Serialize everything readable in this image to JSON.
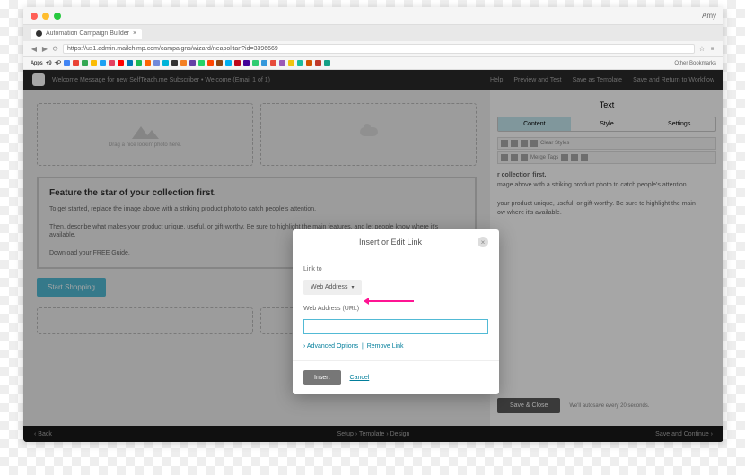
{
  "browser": {
    "user": "Amy",
    "tab": "Automation Campaign Builder",
    "url": "https://us1.admin.mailchimp.com/campaigns/wizard/neapolitan?id=3396669",
    "apps": "Apps",
    "other": "Other Bookmarks",
    "bm1": "+9",
    "bm2": "+P"
  },
  "app": {
    "title": "Welcome Message for new SelfTeach.me Subscriber • Welcome (Email 1 of 1)",
    "help": "Help",
    "preview": "Preview and Test",
    "savetpl": "Save as Template",
    "saveret": "Save and Return to Workflow"
  },
  "editor": {
    "placeholder": "Drag a nice lookin' photo here.",
    "heading": "Feature the star of your collection first.",
    "p1": "To get started, replace the image above with a striking product photo to catch people's attention.",
    "p2": "Then, describe what makes your product unique, useful, or gift-worthy. Be sure to highlight the main features, and let people know where it's available.",
    "p3": "Download your FREE Guide.",
    "shop": "Start Shopping"
  },
  "right": {
    "title": "Text",
    "tab1": "Content",
    "tab2": "Style",
    "tab3": "Settings",
    "clear": "Clear Styles",
    "merge": "Merge Tags",
    "h1": "r collection first.",
    "h2": "mage above with a striking product photo to catch people's attention.",
    "h3": "your product unique, useful, or gift-worthy. Be sure to highlight the main",
    "h4": "ow where it's available.",
    "save": "Save & Close",
    "auto": "We'll autosave every 20 seconds."
  },
  "modal": {
    "title": "Insert or Edit Link",
    "linkto": "Link to",
    "dropdown": "Web Address",
    "urllabel": "Web Address (URL)",
    "adv": "Advanced Options",
    "sep": "|",
    "remove": "Remove Link",
    "insert": "Insert",
    "cancel": "Cancel"
  },
  "footer": {
    "back": "Back",
    "setup": "Setup",
    "template": "Template",
    "design": "Design",
    "cont": "Save and Continue"
  }
}
